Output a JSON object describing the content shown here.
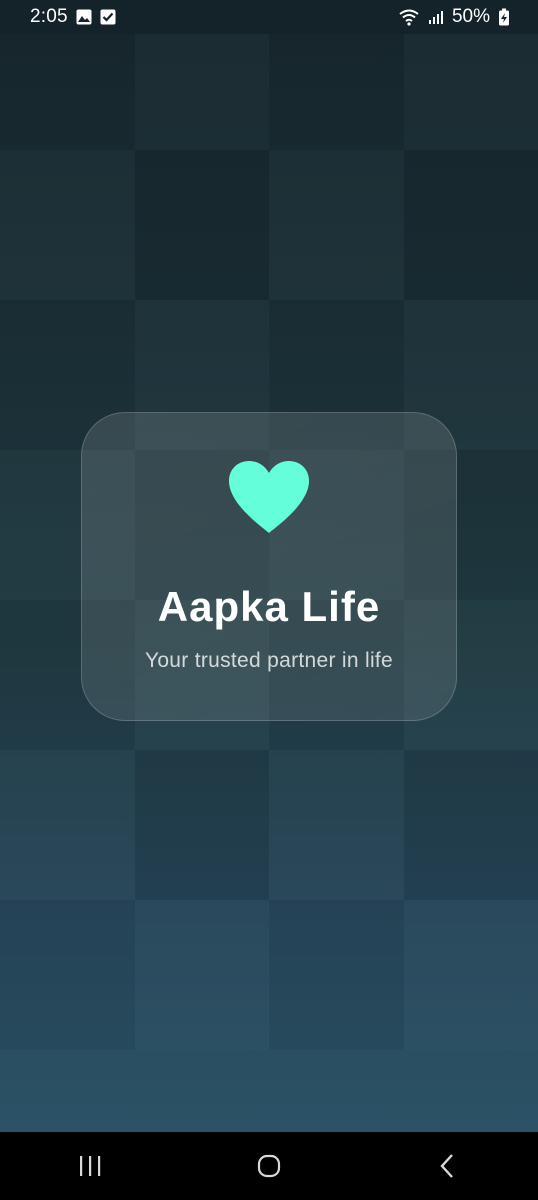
{
  "status_bar": {
    "time": "2:05",
    "battery_percent": "50%",
    "icons_left": [
      "gallery-icon",
      "checkbox-icon"
    ],
    "icons_right": [
      "wifi-icon",
      "signal-icon",
      "battery-icon"
    ]
  },
  "card": {
    "icon": "heart-icon",
    "title": "Aapka Life",
    "tagline": "Your trusted partner in life"
  },
  "nav_bar": {
    "buttons": [
      "recents-button",
      "home-button",
      "back-button"
    ]
  },
  "colors": {
    "accent": "#64FFDA",
    "background_top": "#18292f",
    "background_bottom": "#2b5266",
    "text": "#ffffff"
  }
}
